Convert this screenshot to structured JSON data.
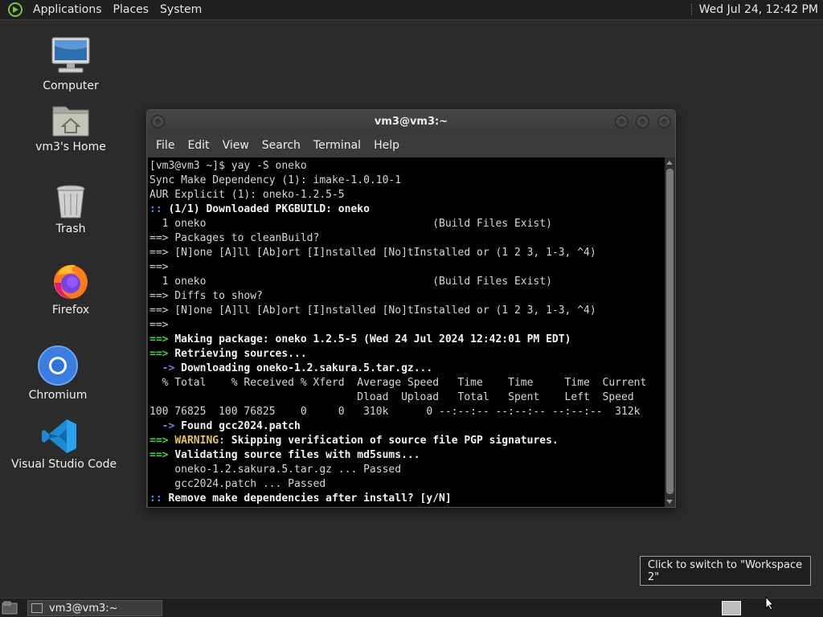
{
  "top_panel": {
    "menus": [
      "Applications",
      "Places",
      "System"
    ],
    "clock": "Wed Jul 24, 12:42 PM"
  },
  "desktop_icons": [
    {
      "label": "Computer",
      "icon": "computer-icon"
    },
    {
      "label": "vm3's Home",
      "icon": "home-folder-icon"
    },
    {
      "label": "Trash",
      "icon": "trash-icon"
    },
    {
      "label": "Firefox",
      "icon": "firefox-icon"
    },
    {
      "label": "Chromium",
      "icon": "chromium-icon"
    },
    {
      "label": "Visual Studio Code",
      "icon": "vscode-icon"
    }
  ],
  "window": {
    "title": "vm3@vm3:~",
    "menus": [
      "File",
      "Edit",
      "View",
      "Search",
      "Terminal",
      "Help"
    ]
  },
  "terminal": {
    "lines": [
      {
        "s": [
          {
            "t": "[vm3@vm3 ~]$ yay -S oneko",
            "c": ""
          }
        ]
      },
      {
        "s": [
          {
            "t": "Sync Make Dependency (1): imake-1.0.10-1",
            "c": ""
          }
        ]
      },
      {
        "s": [
          {
            "t": "AUR Explicit (1): oneko-1.2.5-5",
            "c": ""
          }
        ]
      },
      {
        "s": [
          {
            "t": ":: ",
            "c": "bl"
          },
          {
            "t": "(1/1) Downloaded PKGBUILD: oneko",
            "c": "b"
          }
        ]
      },
      {
        "s": [
          {
            "t": "  1 oneko                                    (Build Files Exist)",
            "c": ""
          }
        ]
      },
      {
        "s": [
          {
            "t": "==> ",
            "c": ""
          },
          {
            "t": "Packages to cleanBuild?",
            "c": ""
          }
        ]
      },
      {
        "s": [
          {
            "t": "==> [N]one [A]ll [Ab]ort [I]nstalled [No]tInstalled or (1 2 3, 1-3, ^4)",
            "c": ""
          }
        ]
      },
      {
        "s": [
          {
            "t": "==>",
            "c": ""
          }
        ]
      },
      {
        "s": [
          {
            "t": "  1 oneko                                    (Build Files Exist)",
            "c": ""
          }
        ]
      },
      {
        "s": [
          {
            "t": "==> Diffs to show?",
            "c": ""
          }
        ]
      },
      {
        "s": [
          {
            "t": "==> [N]one [A]ll [Ab]ort [I]nstalled [No]tInstalled or (1 2 3, 1-3, ^4)",
            "c": ""
          }
        ]
      },
      {
        "s": [
          {
            "t": "==>",
            "c": ""
          }
        ]
      },
      {
        "s": [
          {
            "t": "==> ",
            "c": "g"
          },
          {
            "t": "Making package: oneko 1.2.5-5 (Wed 24 Jul 2024 12:42:01 PM EDT)",
            "c": "b"
          }
        ]
      },
      {
        "s": [
          {
            "t": "==> ",
            "c": "g"
          },
          {
            "t": "Retrieving sources...",
            "c": "b"
          }
        ]
      },
      {
        "s": [
          {
            "t": "  -> ",
            "c": "bl"
          },
          {
            "t": "Downloading oneko-1.2.sakura.5.tar.gz...",
            "c": "b"
          }
        ]
      },
      {
        "s": [
          {
            "t": "  % Total    % Received % Xferd  Average Speed   Time    Time     Time  Current",
            "c": ""
          }
        ]
      },
      {
        "s": [
          {
            "t": "                                 Dload  Upload   Total   Spent    Left  Speed",
            "c": ""
          }
        ]
      },
      {
        "s": [
          {
            "t": "100 76825  100 76825    0     0   310k      0 --:--:-- --:--:-- --:--:--  312k",
            "c": ""
          }
        ]
      },
      {
        "s": [
          {
            "t": "  -> ",
            "c": "bl"
          },
          {
            "t": "Found gcc2024.patch",
            "c": "b"
          }
        ]
      },
      {
        "s": [
          {
            "t": "==> ",
            "c": "g"
          },
          {
            "t": "WARNING:",
            "c": "y"
          },
          {
            "t": " Skipping verification of source file PGP signatures.",
            "c": "b"
          }
        ]
      },
      {
        "s": [
          {
            "t": "==> ",
            "c": "g"
          },
          {
            "t": "Validating source files with md5sums...",
            "c": "b"
          }
        ]
      },
      {
        "s": [
          {
            "t": "    oneko-1.2.sakura.5.tar.gz ... Passed",
            "c": ""
          }
        ]
      },
      {
        "s": [
          {
            "t": "    gcc2024.patch ... Passed",
            "c": ""
          }
        ]
      },
      {
        "s": [
          {
            "t": ":: ",
            "c": "bl"
          },
          {
            "t": "Remove make dependencies after install? [y/N]",
            "c": "b"
          }
        ]
      }
    ]
  },
  "tooltip": "Click to switch to \"Workspace 2\"",
  "taskbar": {
    "task_label": "vm3@vm3:~"
  }
}
